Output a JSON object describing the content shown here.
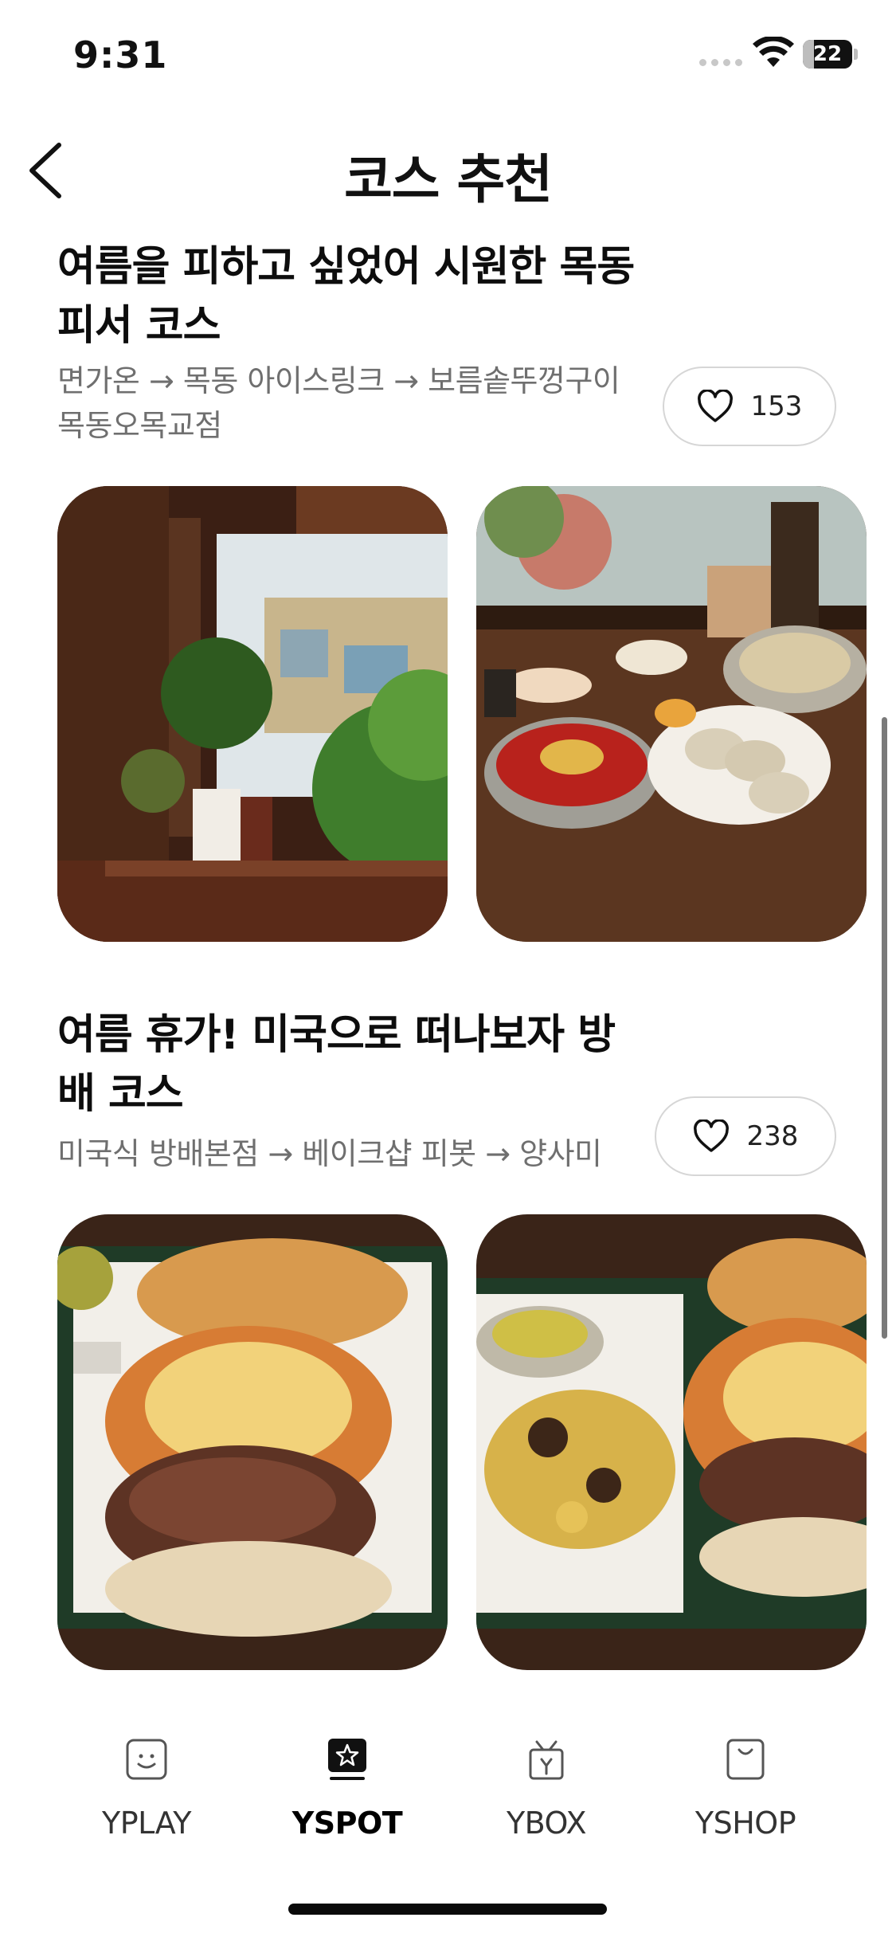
{
  "status_bar": {
    "time": "9:31",
    "battery_level": "22",
    "battery_fraction": 0.22,
    "icons": [
      "cellular-signal-icon",
      "wifi-icon",
      "battery-icon"
    ]
  },
  "header": {
    "title": "코스 추천",
    "back_icon": "chevron-left-icon"
  },
  "courses": [
    {
      "title": "여름을 피하고 싶었어 시원한 목동 피서 코스",
      "route": "면가온 → 목동 아이스링크 → 보름솥뚜껑구이 목동오목교점",
      "likes": "153",
      "photos": [
        "cafe-window-plants-photo",
        "cold-noodles-dumplings-photo"
      ]
    },
    {
      "title": "여름 휴가! 미국으로 떠나보자 방배 코스",
      "route": "미국식 방배본점 → 베이크샵 피봇 → 양사미",
      "likes": "238",
      "photos": [
        "steak-burger-photo",
        "burger-potatoes-tray-photo"
      ]
    }
  ],
  "tabs": [
    {
      "label": "YPLAY",
      "icon": "smiley-bag-icon",
      "active": false
    },
    {
      "label": "YSPOT",
      "icon": "star-badge-icon",
      "active": true
    },
    {
      "label": "YBOX",
      "icon": "gift-box-icon",
      "active": false
    },
    {
      "label": "YSHOP",
      "icon": "shopping-bag-icon",
      "active": false
    }
  ],
  "colors": {
    "text": "#111111",
    "route_text": "#6f6f6f",
    "border": "#d6d6d6",
    "background": "#ffffff"
  }
}
